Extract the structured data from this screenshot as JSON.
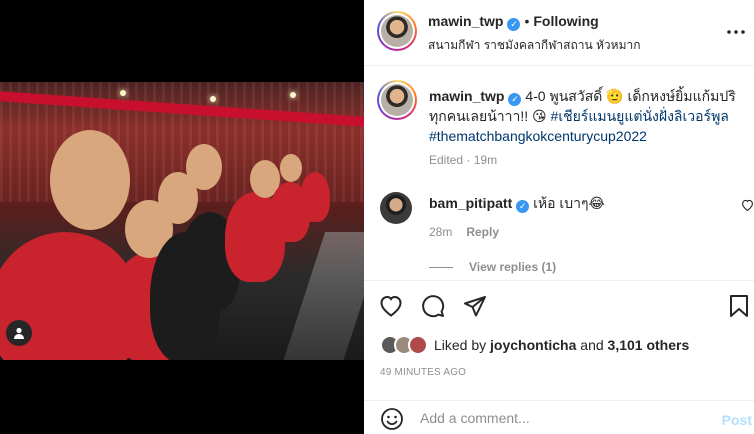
{
  "post": {
    "author": "mawin_twp",
    "verified_mark": "✓",
    "follow_separator": "•",
    "follow_state": "Following",
    "location": "สนามกีฬา ราชมังคลากีฬาสถาน หัวหมาก",
    "caption_text": "4-0 พูนสวัสดิ์ 🫡 เด็กหงษ์ยิ้มแก้มปริทุกคนเลยน้าาา!! 😘",
    "caption_hashtag_1": "#เชียร์แมนยูแต่นั่งฝั่งลิเวอร์พูล",
    "caption_hashtag_2": "#thematchbangkokcenturycup2022",
    "edited_label": "Edited",
    "edited_sep": "·",
    "edited_time": "19m"
  },
  "comment": {
    "author": "bam_pitipatt",
    "text": "เห้อ เบาๆ😂",
    "time": "28m",
    "reply_label": "Reply",
    "view_replies": "View replies (1)"
  },
  "actions": {
    "icons": [
      "heart-icon",
      "comment-icon",
      "share-icon",
      "bookmark-icon"
    ],
    "liked_by_prefix": "Liked by",
    "liked_by_user": "joychonticha",
    "liked_by_and": "and",
    "liked_by_others": "3,101 others",
    "post_time": "49 MINUTES AGO"
  },
  "add_comment": {
    "placeholder": "Add a comment...",
    "post_label": "Post"
  },
  "colors": {
    "verified_blue": "#3897f0",
    "hashtag_blue": "#00376b",
    "post_disabled": "#b2dffc",
    "meta_gray": "#8e8e8e"
  }
}
